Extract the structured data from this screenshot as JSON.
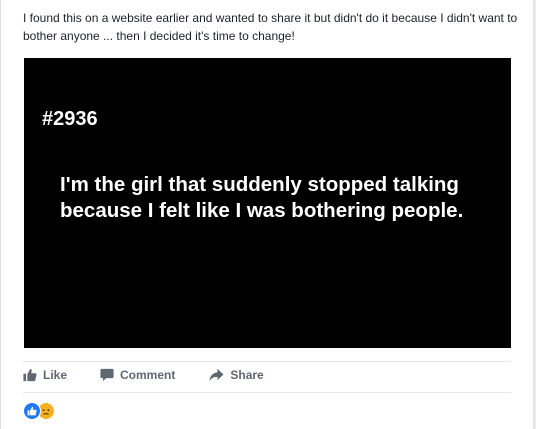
{
  "post": {
    "caption": "I found this on a website earlier and wanted to share it but didn't do it because I didn't want to bother anyone ... then I decided it's time to change!",
    "image": {
      "background": "#000000",
      "number": "#2936",
      "text": "I'm the girl that suddenly stopped talking because I felt like I was bothering people."
    }
  },
  "actions": {
    "like": {
      "label": "Like",
      "icon": "thumbs-up-icon"
    },
    "comment": {
      "label": "Comment",
      "icon": "speech-bubble-icon"
    },
    "share": {
      "label": "Share",
      "icon": "share-arrow-icon"
    }
  },
  "reactions": {
    "icons": [
      "like-reaction-icon",
      "sad-reaction-icon"
    ],
    "colors": {
      "like": "#2078f4",
      "sad": "#f7b125"
    }
  }
}
